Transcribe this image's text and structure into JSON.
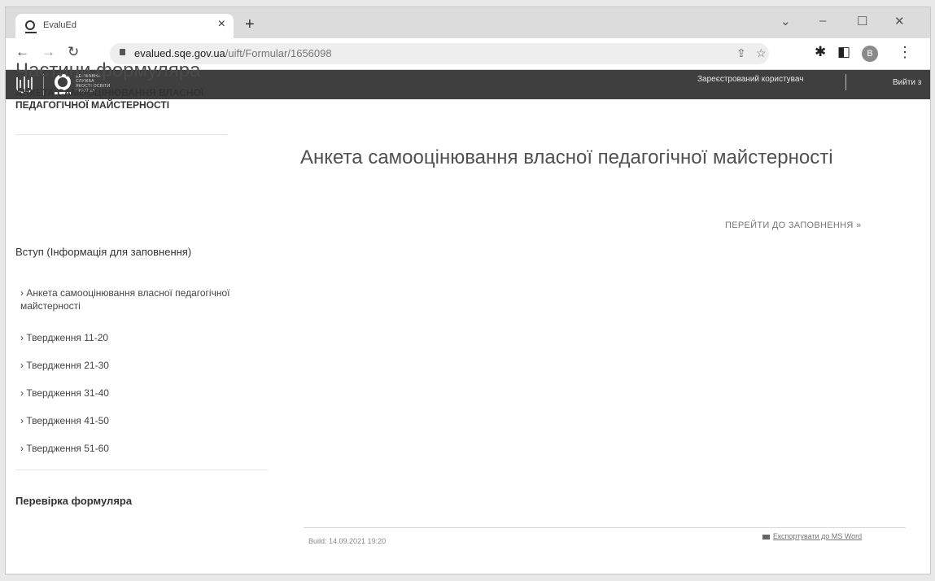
{
  "browser": {
    "tab_title": "EvaluEd",
    "tab_close": "×",
    "new_tab": "+",
    "url_host": "evalued.sqe.gov.ua",
    "url_path": "/uift/Formular/1656098",
    "avatar_initial": "B",
    "controls": {
      "collapse": "⌄",
      "minimize": "–",
      "maximize": "☐",
      "close": "✕"
    },
    "icons": [
      "back-icon",
      "forward-icon",
      "reload-icon",
      "lock-icon",
      "share-icon",
      "star-icon",
      "extensions-icon",
      "side-panel-icon",
      "menu-icon"
    ]
  },
  "header": {
    "logo_lines": [
      "ДЕРЖАВНА",
      "СЛУЖБА",
      "ЯКОСТІ ОСВІТИ",
      "УКРАЇНИ"
    ],
    "registered_user": "Зареєстрований користувач",
    "logout": "Вийти з"
  },
  "sidebar": {
    "title": "Частини формуляра",
    "subtitle": "АНКЕТА САМООЦІНЮВАННЯ ВЛАСНОЇ ПЕДАГОГІЧНОЇ МАЙСТЕРНОСТІ",
    "intro": "Вступ (Інформація для заповнення)",
    "items": [
      {
        "label": "› Анкета самооцінювання власної педагогічної майстерності"
      },
      {
        "label": "› Твердження 11-20"
      },
      {
        "label": "› Твердження 21-30"
      },
      {
        "label": "› Твердження 31-40"
      },
      {
        "label": "› Твердження 41-50"
      },
      {
        "label": "› Твердження 51-60"
      }
    ],
    "check": "Перевірка формуляра"
  },
  "main": {
    "title": "Анкета самооцінювання власної педагогічної майстерності",
    "goto_fill": "ПЕРЕЙТИ ДО ЗАПОВНЕННЯ »",
    "build": "Build: 14.09.2021 19:20",
    "export": "Експортувати до MS Word"
  },
  "colors": {
    "header_bg": "#3f3f3f",
    "tabbar_bg": "#dcdcdc"
  }
}
